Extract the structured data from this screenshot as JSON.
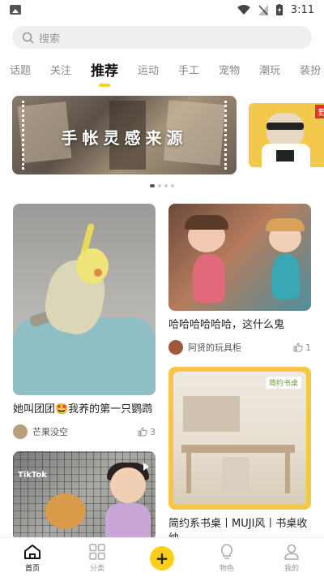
{
  "status_bar": {
    "time": "3:11",
    "icons": [
      "image-icon",
      "wifi-icon",
      "signal-off-icon",
      "battery-charging-icon"
    ]
  },
  "search": {
    "placeholder": "搜索"
  },
  "tabs": [
    {
      "label": "话题"
    },
    {
      "label": "关注"
    },
    {
      "label": "推荐",
      "active": true
    },
    {
      "label": "运动"
    },
    {
      "label": "手工"
    },
    {
      "label": "宠物"
    },
    {
      "label": "潮玩"
    },
    {
      "label": "装扮"
    }
  ],
  "banner": {
    "title": "手帐灵感来源",
    "secondary_tag": "野",
    "pager": {
      "count": 4,
      "active": 0
    }
  },
  "feed": {
    "left": [
      {
        "caption": "她叫团团🤩我养的第一只鹦鹉",
        "author": "芒果没空",
        "likes": "3",
        "avatar_color": "#b9a07c"
      },
      {
        "caption": "",
        "author": "",
        "likes": "",
        "watermark": "TikTok"
      }
    ],
    "right": [
      {
        "caption": "哈哈哈哈哈哈，这什么鬼",
        "author": "阿贤的玩具柜",
        "likes": "1",
        "avatar_color": "#a0583b"
      },
      {
        "caption": "简约系书桌丨MUJI风丨书桌收纳",
        "image_label": "简约书桌"
      }
    ]
  },
  "bottom_nav": [
    {
      "label": "首页",
      "active": true,
      "icon": "home-icon"
    },
    {
      "label": "分类",
      "icon": "grid-icon"
    },
    {
      "label": "",
      "icon": "plus-icon"
    },
    {
      "label": "物色",
      "icon": "bulb-icon"
    },
    {
      "label": "我的",
      "icon": "person-icon"
    }
  ],
  "colors": {
    "accent": "#ffd11a",
    "text": "#222222",
    "muted": "#999999"
  }
}
